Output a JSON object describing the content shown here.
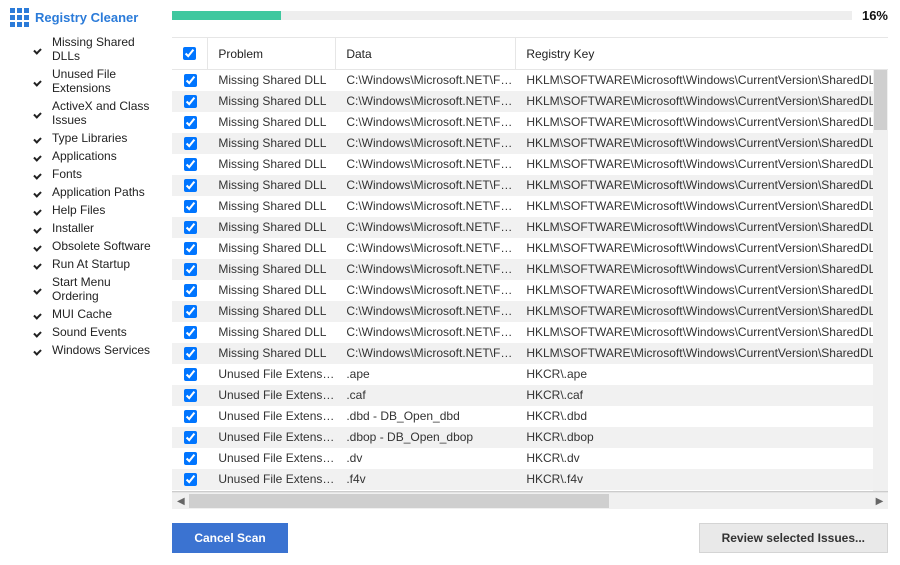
{
  "sidebar": {
    "title": "Registry Cleaner",
    "items": [
      "Missing Shared DLLs",
      "Unused File Extensions",
      "ActiveX and Class Issues",
      "Type Libraries",
      "Applications",
      "Fonts",
      "Application Paths",
      "Help Files",
      "Installer",
      "Obsolete Software",
      "Run At Startup",
      "Start Menu Ordering",
      "MUI Cache",
      "Sound Events",
      "Windows Services"
    ]
  },
  "progress": {
    "percent": 16,
    "label": "16%"
  },
  "table": {
    "headers": {
      "problem": "Problem",
      "data": "Data",
      "key": "Registry Key"
    },
    "rows": [
      {
        "problem": "Missing Shared DLL",
        "data": "C:\\Windows\\Microsoft.NET\\Fra...",
        "key": "HKLM\\SOFTWARE\\Microsoft\\Windows\\CurrentVersion\\SharedDLLs"
      },
      {
        "problem": "Missing Shared DLL",
        "data": "C:\\Windows\\Microsoft.NET\\Fra...",
        "key": "HKLM\\SOFTWARE\\Microsoft\\Windows\\CurrentVersion\\SharedDLLs"
      },
      {
        "problem": "Missing Shared DLL",
        "data": "C:\\Windows\\Microsoft.NET\\Fra...",
        "key": "HKLM\\SOFTWARE\\Microsoft\\Windows\\CurrentVersion\\SharedDLLs"
      },
      {
        "problem": "Missing Shared DLL",
        "data": "C:\\Windows\\Microsoft.NET\\Fra...",
        "key": "HKLM\\SOFTWARE\\Microsoft\\Windows\\CurrentVersion\\SharedDLLs"
      },
      {
        "problem": "Missing Shared DLL",
        "data": "C:\\Windows\\Microsoft.NET\\Fra...",
        "key": "HKLM\\SOFTWARE\\Microsoft\\Windows\\CurrentVersion\\SharedDLLs"
      },
      {
        "problem": "Missing Shared DLL",
        "data": "C:\\Windows\\Microsoft.NET\\Fra...",
        "key": "HKLM\\SOFTWARE\\Microsoft\\Windows\\CurrentVersion\\SharedDLLs"
      },
      {
        "problem": "Missing Shared DLL",
        "data": "C:\\Windows\\Microsoft.NET\\Fra...",
        "key": "HKLM\\SOFTWARE\\Microsoft\\Windows\\CurrentVersion\\SharedDLLs"
      },
      {
        "problem": "Missing Shared DLL",
        "data": "C:\\Windows\\Microsoft.NET\\Fra...",
        "key": "HKLM\\SOFTWARE\\Microsoft\\Windows\\CurrentVersion\\SharedDLLs"
      },
      {
        "problem": "Missing Shared DLL",
        "data": "C:\\Windows\\Microsoft.NET\\Fra...",
        "key": "HKLM\\SOFTWARE\\Microsoft\\Windows\\CurrentVersion\\SharedDLLs"
      },
      {
        "problem": "Missing Shared DLL",
        "data": "C:\\Windows\\Microsoft.NET\\Fra...",
        "key": "HKLM\\SOFTWARE\\Microsoft\\Windows\\CurrentVersion\\SharedDLLs"
      },
      {
        "problem": "Missing Shared DLL",
        "data": "C:\\Windows\\Microsoft.NET\\Fra...",
        "key": "HKLM\\SOFTWARE\\Microsoft\\Windows\\CurrentVersion\\SharedDLLs"
      },
      {
        "problem": "Missing Shared DLL",
        "data": "C:\\Windows\\Microsoft.NET\\Fra...",
        "key": "HKLM\\SOFTWARE\\Microsoft\\Windows\\CurrentVersion\\SharedDLLs"
      },
      {
        "problem": "Missing Shared DLL",
        "data": "C:\\Windows\\Microsoft.NET\\Fra...",
        "key": "HKLM\\SOFTWARE\\Microsoft\\Windows\\CurrentVersion\\SharedDLLs"
      },
      {
        "problem": "Missing Shared DLL",
        "data": "C:\\Windows\\Microsoft.NET\\Fra...",
        "key": "HKLM\\SOFTWARE\\Microsoft\\Windows\\CurrentVersion\\SharedDLLs"
      },
      {
        "problem": "Unused File Extension",
        "data": ".ape",
        "key": "HKCR\\.ape"
      },
      {
        "problem": "Unused File Extension",
        "data": ".caf",
        "key": "HKCR\\.caf"
      },
      {
        "problem": "Unused File Extension",
        "data": ".dbd - DB_Open_dbd",
        "key": "HKCR\\.dbd"
      },
      {
        "problem": "Unused File Extension",
        "data": ".dbop - DB_Open_dbop",
        "key": "HKCR\\.dbop"
      },
      {
        "problem": "Unused File Extension",
        "data": ".dv",
        "key": "HKCR\\.dv"
      },
      {
        "problem": "Unused File Extension",
        "data": ".f4v",
        "key": "HKCR\\.f4v"
      }
    ]
  },
  "footer": {
    "cancel": "Cancel Scan",
    "review": "Review selected Issues..."
  }
}
